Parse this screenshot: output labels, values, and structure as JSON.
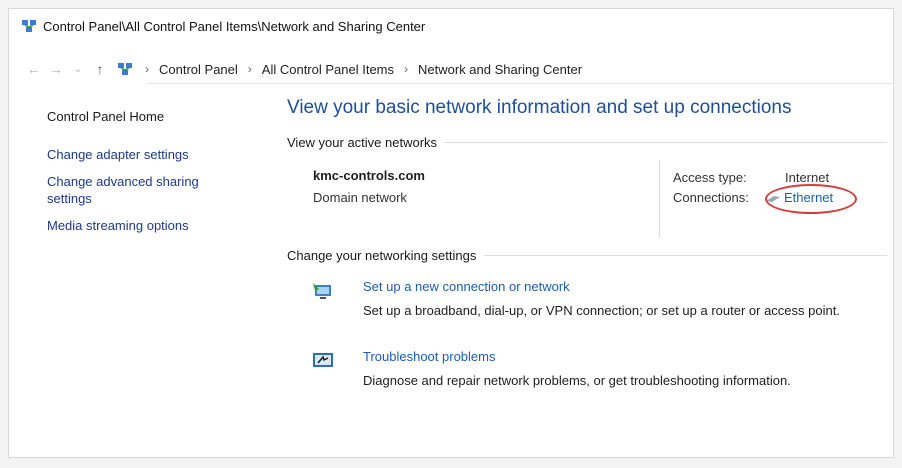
{
  "window": {
    "title": "Control Panel\\All Control Panel Items\\Network and Sharing Center"
  },
  "address": {
    "crumbs": [
      "Control Panel",
      "All Control Panel Items",
      "Network and Sharing Center"
    ]
  },
  "sidebar": {
    "home": "Control Panel Home",
    "links": [
      "Change adapter settings",
      "Change advanced sharing settings",
      "Media streaming options"
    ]
  },
  "main": {
    "title": "View your basic network information and set up connections",
    "active_networks_heading": "View your active networks",
    "network": {
      "name": "kmc-controls.com",
      "type": "Domain network",
      "access_type_label": "Access type:",
      "access_type_value": "Internet",
      "connections_label": "Connections:",
      "connections_value": "Ethernet"
    },
    "change_settings_heading": "Change your networking settings",
    "tasks": [
      {
        "link": "Set up a new connection or network",
        "desc": "Set up a broadband, dial-up, or VPN connection; or set up a router or access point."
      },
      {
        "link": "Troubleshoot problems",
        "desc": "Diagnose and repair network problems, or get troubleshooting information."
      }
    ]
  },
  "colors": {
    "link": "#1a5fb4",
    "title": "#1f4e9c",
    "highlight_circle": "#d43c3c"
  }
}
